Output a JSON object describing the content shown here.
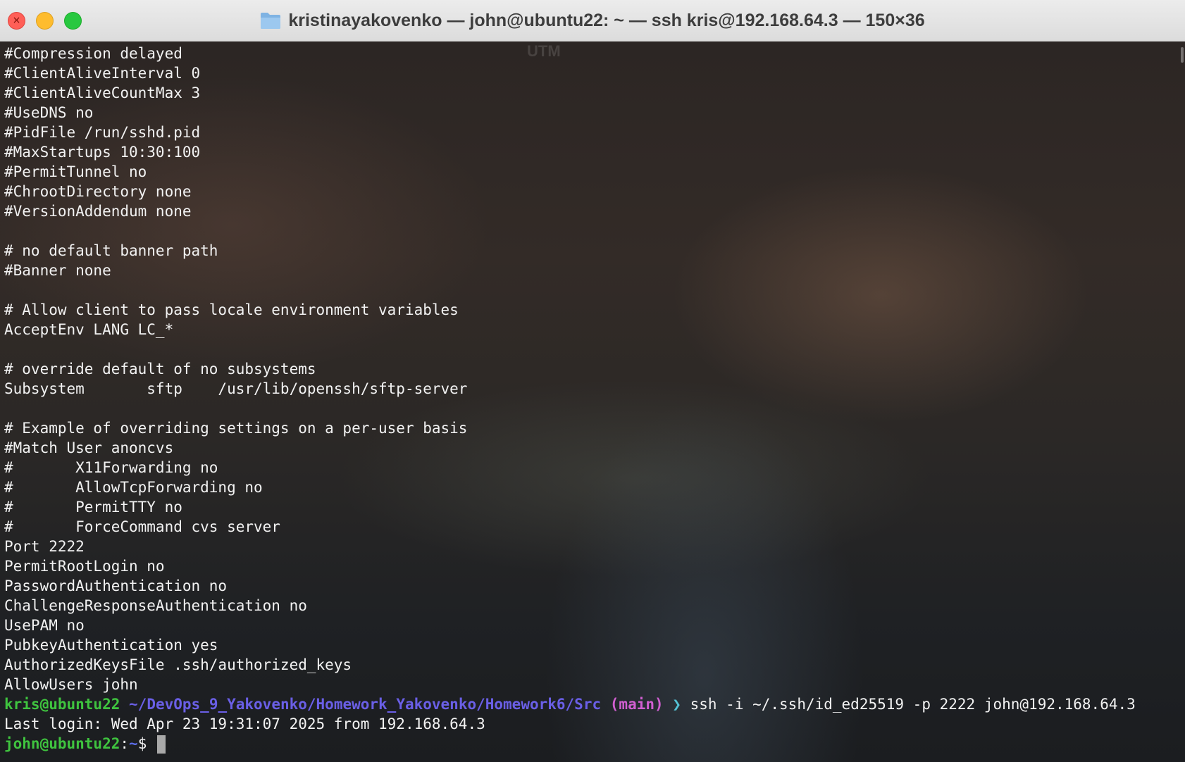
{
  "window": {
    "title": "kristinayakovenko — john@ubuntu22: ~ — ssh kris@192.168.64.3 — 150×36",
    "watermark": "UTM"
  },
  "terminal": {
    "lines": [
      "#Compression delayed",
      "#ClientAliveInterval 0",
      "#ClientAliveCountMax 3",
      "#UseDNS no",
      "#PidFile /run/sshd.pid",
      "#MaxStartups 10:30:100",
      "#PermitTunnel no",
      "#ChrootDirectory none",
      "#VersionAddendum none",
      "",
      "# no default banner path",
      "#Banner none",
      "",
      "# Allow client to pass locale environment variables",
      "AcceptEnv LANG LC_*",
      "",
      "# override default of no subsystems",
      "Subsystem       sftp    /usr/lib/openssh/sftp-server",
      "",
      "# Example of overriding settings on a per-user basis",
      "#Match User anoncvs",
      "#       X11Forwarding no",
      "#       AllowTcpForwarding no",
      "#       PermitTTY no",
      "#       ForceCommand cvs server",
      "Port 2222",
      "PermitRootLogin no",
      "PasswordAuthentication no",
      "ChallengeResponseAuthentication no",
      "UsePAM no",
      "PubkeyAuthentication yes",
      "AuthorizedKeysFile .ssh/authorized_keys",
      "AllowUsers john"
    ],
    "prompt1": {
      "user_host": "kris@ubuntu22",
      "path": "~/DevOps_9_Yakovenko/Homework_Yakovenko/Homework6/Src",
      "branch": "(main)",
      "arrow": "❯",
      "command": "ssh -i ~/.ssh/id_ed25519 -p 2222 john@192.168.64.3"
    },
    "last_login": "Last login: Wed Apr 23 19:31:07 2025 from 192.168.64.3",
    "prompt2": {
      "user_host": "john@ubuntu22",
      "path": "~",
      "symbol": "$"
    }
  },
  "colors": {
    "prompt_green": "#3fc43f",
    "path_purple": "#6a5fe6",
    "branch_pink": "#d15fd1",
    "arrow_cyan": "#55c3d6",
    "john_path_blue": "#5c6de8"
  }
}
